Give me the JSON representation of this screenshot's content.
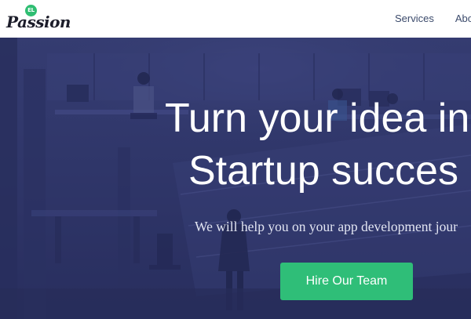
{
  "brand": {
    "badge": "EL",
    "name": "Passion",
    "accent_color": "#2fbe72"
  },
  "nav": {
    "items": [
      {
        "label": "Services"
      },
      {
        "label": "Abo"
      }
    ]
  },
  "hero": {
    "title_line1": "Turn your idea in",
    "title_line2": "Startup succes",
    "subtitle": "We will help you on your app development jour",
    "cta_label": "Hire Our Team",
    "overlay_color": "#2e3568",
    "cta_color": "#2fbe78"
  }
}
